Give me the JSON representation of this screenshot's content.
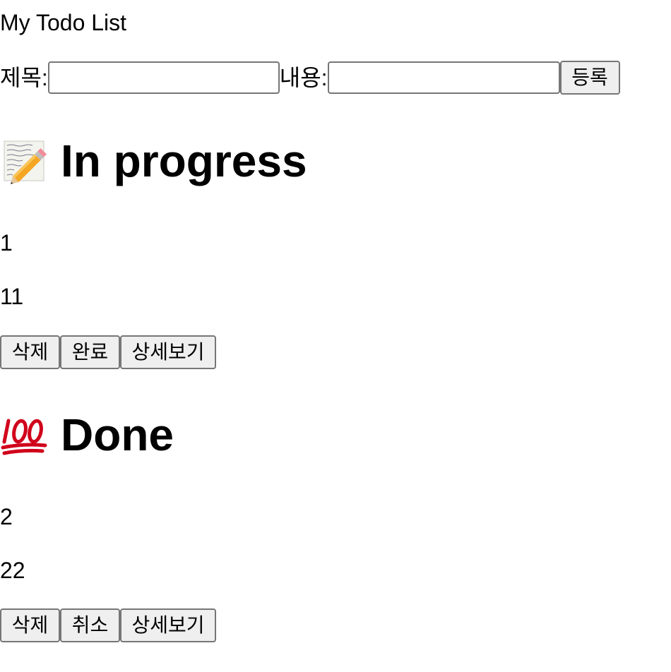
{
  "app": {
    "title": "My Todo List"
  },
  "form": {
    "title_label": "제목:",
    "title_value": "",
    "content_label": "내용:",
    "content_value": "",
    "submit_label": "등록"
  },
  "sections": {
    "in_progress": {
      "icon": "memo-pencil-icon",
      "heading": "In progress",
      "items": [
        {
          "title": "1",
          "content": "11",
          "delete_label": "삭제",
          "toggle_label": "완료",
          "detail_label": "상세보기"
        }
      ]
    },
    "done": {
      "icon": "hundred-points-icon",
      "heading": "Done",
      "items": [
        {
          "title": "2",
          "content": "22",
          "delete_label": "삭제",
          "toggle_label": "취소",
          "detail_label": "상세보기"
        }
      ]
    }
  },
  "colors": {
    "button_bg": "#efefef",
    "border": "#767676",
    "hundred_red": "#d0021b"
  }
}
